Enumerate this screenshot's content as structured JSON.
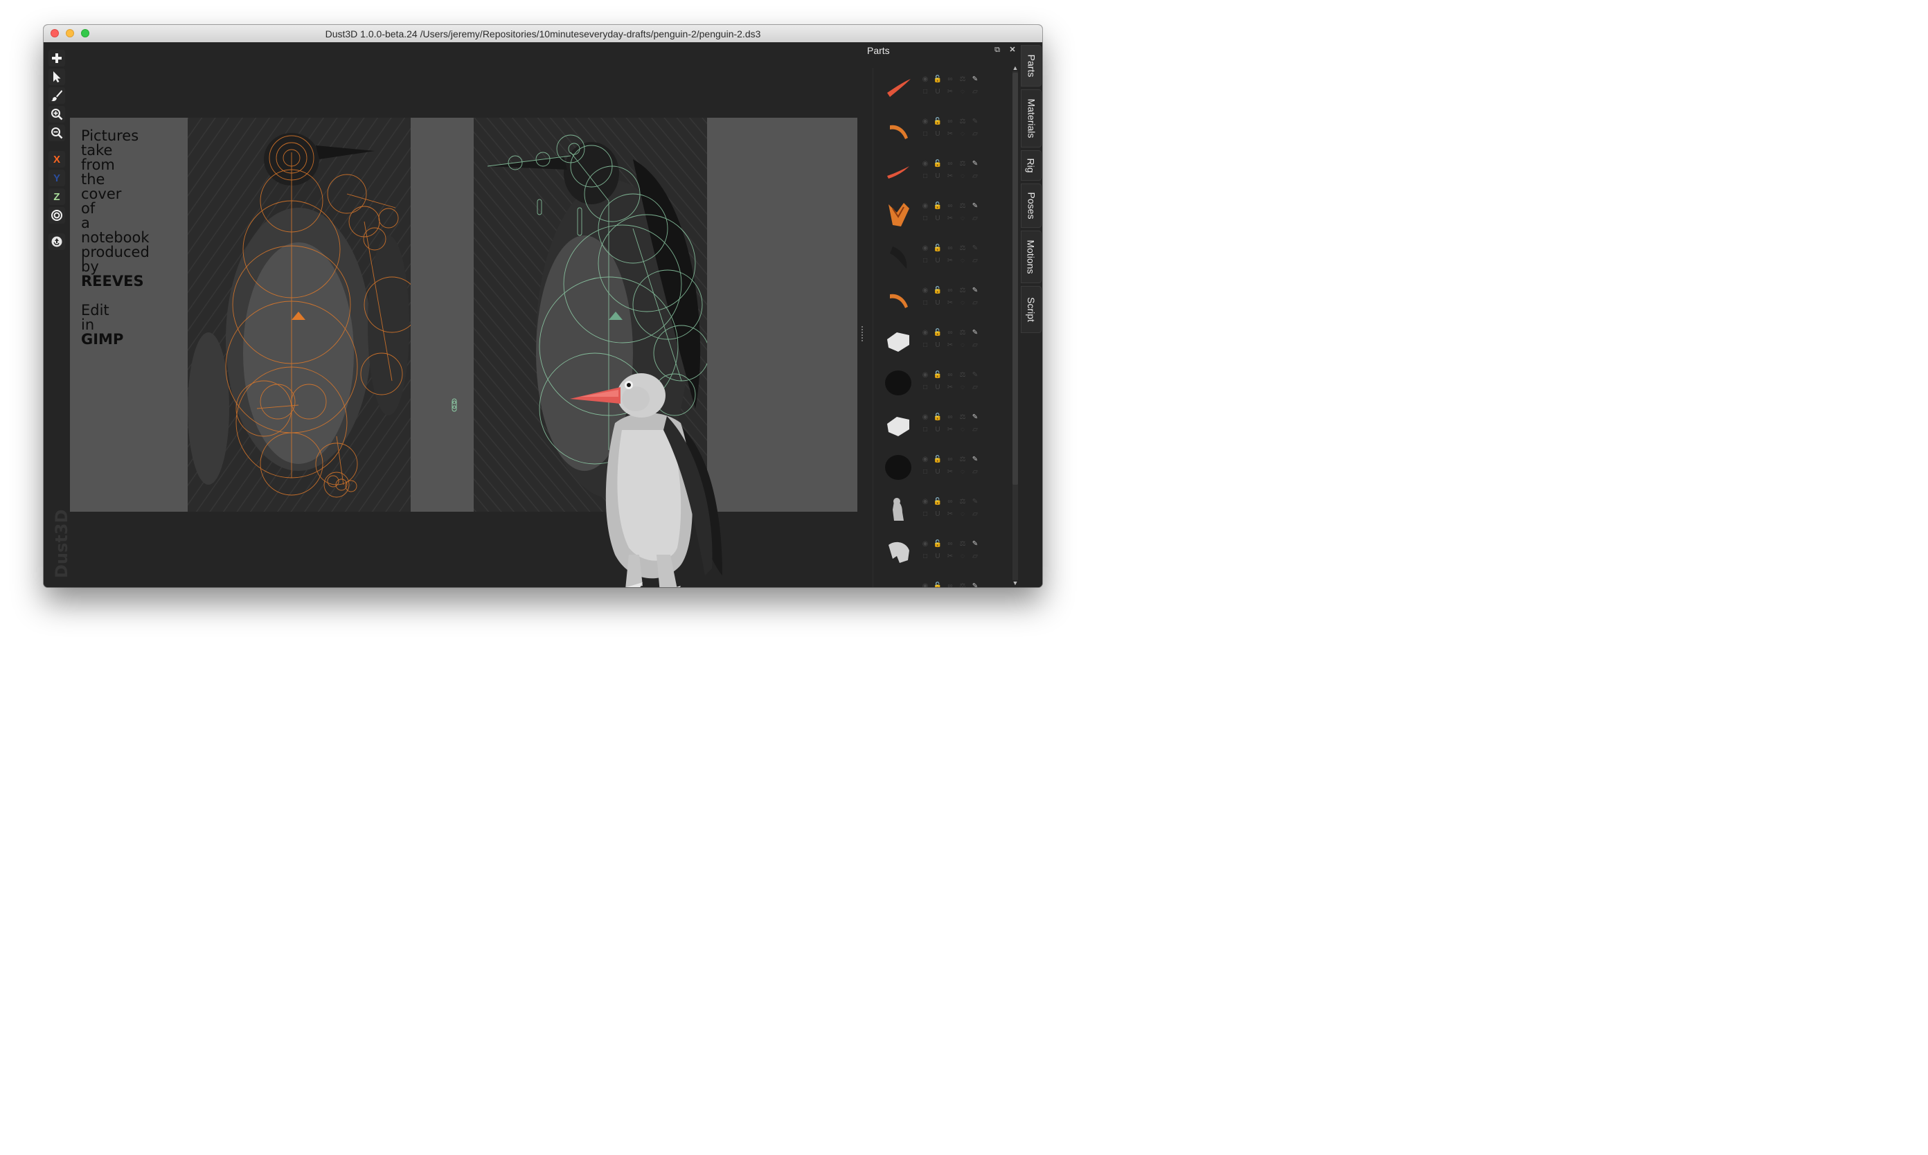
{
  "window": {
    "title": "Dust3D 1.0.0-beta.24 /Users/jeremy/Repositories/10minuteseveryday-drafts/penguin-2/penguin-2.ds3"
  },
  "toolbar": {
    "tools": [
      {
        "name": "add-icon",
        "glyph": "+"
      },
      {
        "name": "select-icon",
        "glyph": "arrow"
      },
      {
        "name": "paint-brush-icon",
        "glyph": "brush"
      },
      {
        "name": "zoom-in-icon",
        "glyph": "zoom+"
      },
      {
        "name": "zoom-out-icon",
        "glyph": "zoom-"
      }
    ],
    "axis_x": "X",
    "axis_y": "Y",
    "axis_z": "Z",
    "axis_colors": {
      "x": "#fc6621",
      "y": "#2a4d9e",
      "z": "#a9dd9b"
    },
    "radius_icon": "target-icon",
    "regenerate_icon": "recycle-icon",
    "brand": "Dust3D"
  },
  "canvas": {
    "note_lines": [
      "Pictures",
      "take",
      "from",
      "the",
      "cover",
      "of",
      "a",
      "notebook",
      "produced",
      "by"
    ],
    "note_strong": "REEVES",
    "note2_lines": [
      "Edit",
      "in"
    ],
    "note2_strong": "GIMP"
  },
  "parts_panel": {
    "title": "Parts",
    "float_icon": "float-window-icon",
    "close_icon": "close-icon",
    "parts": [
      {
        "thumb_color": "#e2553a",
        "shape": "beak"
      },
      {
        "thumb_color": "#e07a2a",
        "shape": "curve"
      },
      {
        "thumb_color": "#e2553a",
        "shape": "beak-small"
      },
      {
        "thumb_color": "#e07a2a",
        "shape": "feet"
      },
      {
        "thumb_color": "#1c1c1c",
        "shape": "wing-dark"
      },
      {
        "thumb_color": "#e07a2a",
        "shape": "curve"
      },
      {
        "thumb_color": "#e6e6e6",
        "shape": "rock"
      },
      {
        "thumb_color": "#111111",
        "shape": "blob"
      },
      {
        "thumb_color": "#e6e6e6",
        "shape": "rock"
      },
      {
        "thumb_color": "#111111",
        "shape": "blob"
      },
      {
        "thumb_color": "#bdbdbd",
        "shape": "figure"
      },
      {
        "thumb_color": "#d0d0d0",
        "shape": "figure-large"
      },
      {
        "thumb_color": "#888888",
        "shape": "partial"
      }
    ]
  },
  "side_tabs": [
    "Parts",
    "Materials",
    "Rig",
    "Poses",
    "Motions",
    "Script"
  ]
}
